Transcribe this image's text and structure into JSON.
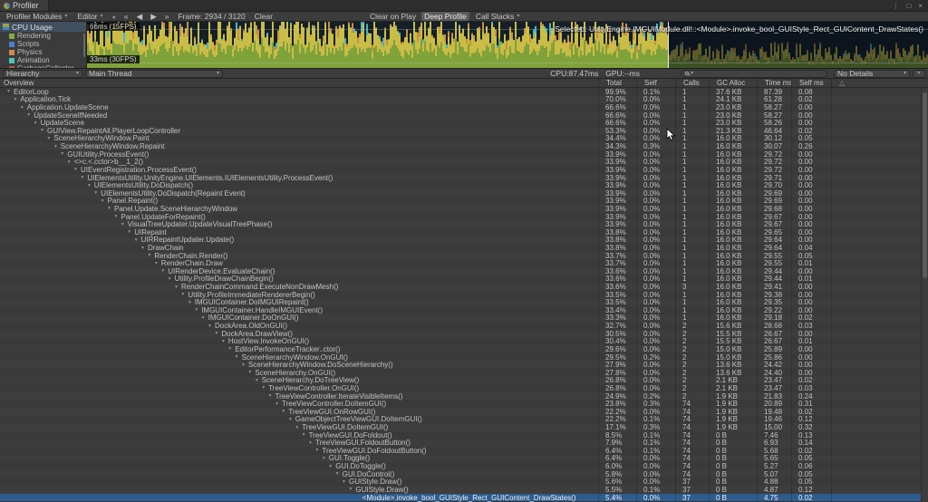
{
  "window": {
    "title": "Profiler"
  },
  "icons": {
    "dropdown_arrow": "▾",
    "record": "●",
    "first_frame": "«",
    "prev_frame": "◀",
    "next_frame": "▶",
    "last_frame": "»",
    "menu": "⋮",
    "maximize": "□",
    "close": "×",
    "foldout": "▼",
    "warning": "△",
    "sort": "▾"
  },
  "toolbar": {
    "profiler_modules": "Profiler Modules",
    "editor": "Editor",
    "frame_label": "Frame:",
    "frame_current": "2934",
    "frame_sep": "/",
    "frame_total": "3120",
    "clear": "Clear",
    "clear_on_play": "Clear on Play",
    "deep_profile": "Deep Profile",
    "call_stacks": "Call Stacks"
  },
  "modules": {
    "cpu_usage": "CPU Usage",
    "legend": [
      {
        "label": "Rendering",
        "color": "#7fae3c"
      },
      {
        "label": "Scripts",
        "color": "#4c7ecf"
      },
      {
        "label": "Physics",
        "color": "#cf8b4c"
      },
      {
        "label": "Animation",
        "color": "#4cc3b6"
      },
      {
        "label": "GarbageCollector",
        "color": "#b5554d"
      }
    ]
  },
  "chart": {
    "selected_label": "Selected: UnityEngine.IMGUIModule.dll!::<Module>.invoke_bool_GUIStyle_Rect_GUIContent_DrawStates()",
    "line_66": "66ms (15FPS)",
    "line_33": "33ms (30FPS)"
  },
  "hierarchy_bar": {
    "view_mode": "Hierarchy",
    "thread": "Main Thread",
    "cpu": "CPU:87.47ms",
    "gpu": "GPU:--ms",
    "details": "No Details"
  },
  "table": {
    "columns": {
      "overview": "Overview",
      "total": "Total",
      "self": "Self",
      "calls": "Calls",
      "gc": "GC Alloc",
      "time": "Time ms",
      "selfms": "Self ms"
    },
    "selected_index": 52,
    "rows": [
      {
        "name": "EditorLoop",
        "indent": 0,
        "total": "99.9%",
        "self": "0.1%",
        "calls": "1",
        "gc": "37.6 KB",
        "time": "87.39",
        "selfms": "0.08"
      },
      {
        "name": "Application.Tick",
        "indent": 1,
        "total": "70.0%",
        "self": "0.0%",
        "calls": "1",
        "gc": "24.1 KB",
        "time": "61.28",
        "selfms": "0.02"
      },
      {
        "name": "Application.UpdateScene",
        "indent": 2,
        "total": "66.6%",
        "self": "0.0%",
        "calls": "1",
        "gc": "23.0 KB",
        "time": "58.27",
        "selfms": "0.00"
      },
      {
        "name": "UpdateSceneIfNeeded",
        "indent": 3,
        "total": "66.6%",
        "self": "0.0%",
        "calls": "1",
        "gc": "23.0 KB",
        "time": "58.27",
        "selfms": "0.00"
      },
      {
        "name": "UpdateScene",
        "indent": 4,
        "total": "66.6%",
        "self": "0.0%",
        "calls": "1",
        "gc": "23.0 KB",
        "time": "58.26",
        "selfms": "0.00"
      },
      {
        "name": "GUIView.RepaintAll.PlayerLoopController",
        "indent": 5,
        "total": "53.3%",
        "self": "0.0%",
        "calls": "1",
        "gc": "21.3 KB",
        "time": "46.64",
        "selfms": "0.02"
      },
      {
        "name": "SceneHierarchyWindow.Paint",
        "indent": 6,
        "total": "34.4%",
        "self": "0.0%",
        "calls": "1",
        "gc": "16.0 KB",
        "time": "30.12",
        "selfms": "0.05"
      },
      {
        "name": "SceneHierarchyWindow.Repaint",
        "indent": 7,
        "total": "34.3%",
        "self": "0.3%",
        "calls": "1",
        "gc": "16.0 KB",
        "time": "30.07",
        "selfms": "0.26"
      },
      {
        "name": "GUIUtility.ProcessEvent()",
        "indent": 8,
        "total": "33.9%",
        "self": "0.0%",
        "calls": "1",
        "gc": "16.0 KB",
        "time": "29.72",
        "selfms": "0.00"
      },
      {
        "name": "<>c.<.cctor>b__1_2()",
        "indent": 9,
        "total": "33.9%",
        "self": "0.0%",
        "calls": "1",
        "gc": "16.0 KB",
        "time": "29.72",
        "selfms": "0.00"
      },
      {
        "name": "UIEventRegistration.ProcessEvent()",
        "indent": 10,
        "total": "33.9%",
        "self": "0.0%",
        "calls": "1",
        "gc": "16.0 KB",
        "time": "29.72",
        "selfms": "0.00"
      },
      {
        "name": "UIElementsUtility.UnityEngine.UIElements.IUIElementsUtility.ProcessEvent()",
        "indent": 11,
        "total": "33.9%",
        "self": "0.0%",
        "calls": "1",
        "gc": "16.0 KB",
        "time": "29.71",
        "selfms": "0.00"
      },
      {
        "name": "UIElementsUtility.DoDispatch()",
        "indent": 12,
        "total": "33.9%",
        "self": "0.0%",
        "calls": "1",
        "gc": "16.0 KB",
        "time": "29.70",
        "selfms": "0.00"
      },
      {
        "name": "UIElementsUtility.DoDispatch(Repaint Event)",
        "indent": 13,
        "total": "33.9%",
        "self": "0.0%",
        "calls": "1",
        "gc": "16.0 KB",
        "time": "29.69",
        "selfms": "0.00"
      },
      {
        "name": "Panel.Repaint()",
        "indent": 14,
        "total": "33.9%",
        "self": "0.0%",
        "calls": "1",
        "gc": "16.0 KB",
        "time": "29.69",
        "selfms": "0.00"
      },
      {
        "name": "Panel.Update.SceneHierarchyWindow",
        "indent": 15,
        "total": "33.9%",
        "self": "0.0%",
        "calls": "1",
        "gc": "16.0 KB",
        "time": "29.68",
        "selfms": "0.00"
      },
      {
        "name": "Panel.UpdateForRepaint()",
        "indent": 16,
        "total": "33.9%",
        "self": "0.0%",
        "calls": "1",
        "gc": "16.0 KB",
        "time": "29.67",
        "selfms": "0.00"
      },
      {
        "name": "VisualTreeUpdater.UpdateVisualTreePhase()",
        "indent": 17,
        "total": "33.9%",
        "self": "0.0%",
        "calls": "1",
        "gc": "16.0 KB",
        "time": "29.67",
        "selfms": "0.00"
      },
      {
        "name": "UIRepaint",
        "indent": 18,
        "total": "33.8%",
        "self": "0.0%",
        "calls": "1",
        "gc": "16.0 KB",
        "time": "29.65",
        "selfms": "0.00"
      },
      {
        "name": "UIRRepaintUpdater.Update()",
        "indent": 19,
        "total": "33.8%",
        "self": "0.0%",
        "calls": "1",
        "gc": "16.0 KB",
        "time": "29.64",
        "selfms": "0.00"
      },
      {
        "name": "DrawChain",
        "indent": 20,
        "total": "33.8%",
        "self": "0.0%",
        "calls": "1",
        "gc": "16.0 KB",
        "time": "29.64",
        "selfms": "0.04"
      },
      {
        "name": "RenderChain.Render()",
        "indent": 21,
        "total": "33.7%",
        "self": "0.0%",
        "calls": "1",
        "gc": "16.0 KB",
        "time": "29.55",
        "selfms": "0.05"
      },
      {
        "name": "RenderChain.Draw",
        "indent": 22,
        "total": "33.7%",
        "self": "0.0%",
        "calls": "1",
        "gc": "16.0 KB",
        "time": "29.55",
        "selfms": "0.01"
      },
      {
        "name": "UIRenderDevice.EvaluateChain()",
        "indent": 23,
        "total": "33.6%",
        "self": "0.0%",
        "calls": "1",
        "gc": "16.0 KB",
        "time": "29.44",
        "selfms": "0.00"
      },
      {
        "name": "Utility.ProfileDrawChainBegin()",
        "indent": 24,
        "total": "33.6%",
        "self": "0.0%",
        "calls": "1",
        "gc": "16.0 KB",
        "time": "29.44",
        "selfms": "0.01"
      },
      {
        "name": "RenderChainCommand.ExecuteNonDrawMesh()",
        "indent": 25,
        "total": "33.6%",
        "self": "0.0%",
        "calls": "3",
        "gc": "16.0 KB",
        "time": "29.41",
        "selfms": "0.00"
      },
      {
        "name": "Utility.ProfileImmediateRendererBegin()",
        "indent": 26,
        "total": "33.5%",
        "self": "0.0%",
        "calls": "1",
        "gc": "16.0 KB",
        "time": "29.38",
        "selfms": "0.00"
      },
      {
        "name": "IMGUIContainer.DoIMGUIRepaint()",
        "indent": 27,
        "total": "33.5%",
        "self": "0.0%",
        "calls": "1",
        "gc": "16.0 KB",
        "time": "29.35",
        "selfms": "0.00"
      },
      {
        "name": "IMGUIContainer.HandleIMGUIEvent()",
        "indent": 28,
        "total": "33.4%",
        "self": "0.0%",
        "calls": "1",
        "gc": "16.0 KB",
        "time": "29.22",
        "selfms": "0.00"
      },
      {
        "name": "IMGUIContainer.DoOnGUI()",
        "indent": 29,
        "total": "33.3%",
        "self": "0.0%",
        "calls": "1",
        "gc": "16.0 KB",
        "time": "29.18",
        "selfms": "0.02"
      },
      {
        "name": "DockArea.OldOnGUI()",
        "indent": 30,
        "total": "32.7%",
        "self": "0.0%",
        "calls": "2",
        "gc": "15.6 KB",
        "time": "28.68",
        "selfms": "0.03"
      },
      {
        "name": "DockArea.DrawView()",
        "indent": 31,
        "total": "30.5%",
        "self": "0.0%",
        "calls": "2",
        "gc": "15.5 KB",
        "time": "26.67",
        "selfms": "0.00"
      },
      {
        "name": "HostView.InvokeOnGUI()",
        "indent": 32,
        "total": "30.4%",
        "self": "0.0%",
        "calls": "2",
        "gc": "15.5 KB",
        "time": "26.67",
        "selfms": "0.01"
      },
      {
        "name": "EditorPerformanceTracker..ctor()",
        "indent": 33,
        "total": "29.6%",
        "self": "0.0%",
        "calls": "2",
        "gc": "15.0 KB",
        "time": "25.89",
        "selfms": "0.00"
      },
      {
        "name": "SceneHierarchyWindow.OnGUI()",
        "indent": 34,
        "total": "29.5%",
        "self": "0.2%",
        "calls": "2",
        "gc": "15.0 KB",
        "time": "25.86",
        "selfms": "0.00"
      },
      {
        "name": "SceneHierarchyWindow.DoSceneHierarchy()",
        "indent": 35,
        "total": "27.9%",
        "self": "0.0%",
        "calls": "2",
        "gc": "13.6 KB",
        "time": "24.42",
        "selfms": "0.00"
      },
      {
        "name": "SceneHierarchy.OnGUI()",
        "indent": 36,
        "total": "27.8%",
        "self": "0.0%",
        "calls": "2",
        "gc": "13.6 KB",
        "time": "24.40",
        "selfms": "0.00"
      },
      {
        "name": "SceneHierarchy.DoTreeView()",
        "indent": 37,
        "total": "26.8%",
        "self": "0.0%",
        "calls": "2",
        "gc": "2.1 KB",
        "time": "23.47",
        "selfms": "0.02"
      },
      {
        "name": "TreeViewController.OnGUI()",
        "indent": 38,
        "total": "26.8%",
        "self": "0.0%",
        "calls": "2",
        "gc": "2.1 KB",
        "time": "23.47",
        "selfms": "0.03"
      },
      {
        "name": "TreeViewController.IterateVisibleItems()",
        "indent": 39,
        "total": "24.9%",
        "self": "0.2%",
        "calls": "2",
        "gc": "1.9 KB",
        "time": "21.83",
        "selfms": "0.24"
      },
      {
        "name": "TreeViewController.DoItemGUI()",
        "indent": 40,
        "total": "23.8%",
        "self": "0.3%",
        "calls": "74",
        "gc": "1.9 KB",
        "time": "20.89",
        "selfms": "0.31"
      },
      {
        "name": "TreeViewGUI.OnRowGUI()",
        "indent": 41,
        "total": "22.2%",
        "self": "0.0%",
        "calls": "74",
        "gc": "1.9 KB",
        "time": "19.48",
        "selfms": "0.02"
      },
      {
        "name": "GameObjectTreeViewGUI.DoItemGUI()",
        "indent": 42,
        "total": "22.2%",
        "self": "0.1%",
        "calls": "74",
        "gc": "1.9 KB",
        "time": "19.46",
        "selfms": "0.12"
      },
      {
        "name": "TreeViewGUI.DoItemGUI()",
        "indent": 43,
        "total": "17.1%",
        "self": "0.3%",
        "calls": "74",
        "gc": "1.9 KB",
        "time": "15.00",
        "selfms": "0.32"
      },
      {
        "name": "TreeViewGUI.DoFoldout()",
        "indent": 44,
        "total": "8.5%",
        "self": "0.1%",
        "calls": "74",
        "gc": "0 B",
        "time": "7.46",
        "selfms": "0.13"
      },
      {
        "name": "TreeViewGUI.FoldoutButton()",
        "indent": 45,
        "total": "7.9%",
        "self": "0.1%",
        "calls": "74",
        "gc": "0 B",
        "time": "6.93",
        "selfms": "0.14"
      },
      {
        "name": "TreeViewGUI.DoFoldoutButton()",
        "indent": 46,
        "total": "6.4%",
        "self": "0.1%",
        "calls": "74",
        "gc": "0 B",
        "time": "5.68",
        "selfms": "0.02"
      },
      {
        "name": "GUI.Toggle()",
        "indent": 47,
        "total": "6.4%",
        "self": "0.0%",
        "calls": "74",
        "gc": "0 B",
        "time": "5.65",
        "selfms": "0.05"
      },
      {
        "name": "GUI.DoToggle()",
        "indent": 48,
        "total": "6.0%",
        "self": "0.0%",
        "calls": "74",
        "gc": "0 B",
        "time": "5.27",
        "selfms": "0.06"
      },
      {
        "name": "GUI.DoControl()",
        "indent": 49,
        "total": "5.8%",
        "self": "0.0%",
        "calls": "74",
        "gc": "0 B",
        "time": "5.07",
        "selfms": "0.05"
      },
      {
        "name": "GUIStyle.Draw()",
        "indent": 50,
        "total": "5.6%",
        "self": "0.0%",
        "calls": "37",
        "gc": "0 B",
        "time": "4.88",
        "selfms": "0.05"
      },
      {
        "name": "GUIStyle.Draw()",
        "indent": 51,
        "total": "5.5%",
        "self": "0.1%",
        "calls": "37",
        "gc": "0 B",
        "time": "4.87",
        "selfms": "0.12"
      },
      {
        "name": "<Module>.invoke_bool_GUIStyle_Rect_GUIContent_DrawStates()",
        "indent": 52,
        "total": "5.4%",
        "self": "0.0%",
        "calls": "37",
        "gc": "0 B",
        "time": "4.75",
        "selfms": "0.02",
        "leaf": true
      }
    ]
  }
}
